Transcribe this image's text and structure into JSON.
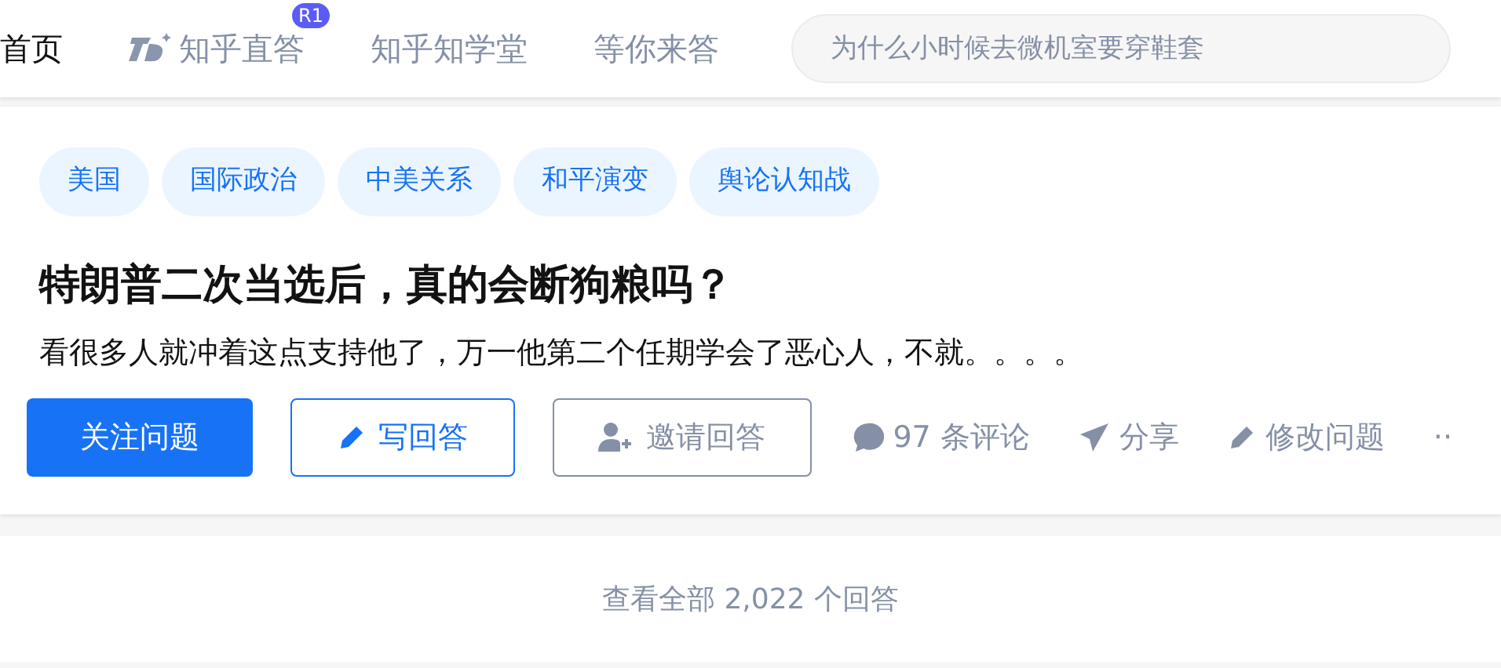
{
  "nav": {
    "tabs": [
      {
        "label": "首页",
        "selected": true,
        "kind": "plain"
      },
      {
        "label": "知乎直答",
        "selected": false,
        "kind": "ai",
        "badge": "R1"
      },
      {
        "label": "知乎知学堂",
        "selected": false,
        "kind": "plain"
      },
      {
        "label": "等你来答",
        "selected": false,
        "kind": "plain"
      }
    ],
    "search": {
      "placeholder": "为什么小时候去微机室要穿鞋套"
    }
  },
  "question": {
    "tags": [
      "美国",
      "国际政治",
      "中美关系",
      "和平演变",
      "舆论认知战"
    ],
    "title": "特朗普二次当选后，真的会断狗粮吗？",
    "detail": "看很多人就冲着这点支持他了，万一他第二个任期学会了恶心人，不就。。。。",
    "buttons": [
      {
        "label": "关注问题",
        "kind": "primary"
      },
      {
        "label": "写回答",
        "kind": "write"
      },
      {
        "label": "邀请回答",
        "kind": "invite"
      }
    ],
    "actions": [
      {
        "label": "97 条评论",
        "kind": "comment"
      },
      {
        "label": "分享",
        "kind": "share"
      },
      {
        "label": "修改问题",
        "kind": "edit"
      },
      {
        "label": "··",
        "kind": "more"
      }
    ]
  },
  "view_all": "查看全部 2,022 个回答"
}
